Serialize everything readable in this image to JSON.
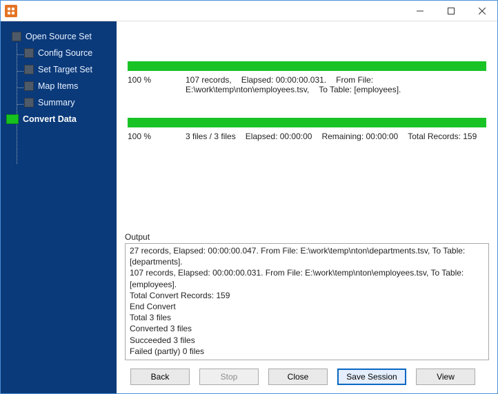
{
  "sidebar": {
    "items": [
      {
        "label": "Open Source Set"
      },
      {
        "label": "Config Source"
      },
      {
        "label": "Set Target Set"
      },
      {
        "label": "Map Items"
      },
      {
        "label": "Summary"
      },
      {
        "label": "Convert Data"
      }
    ]
  },
  "progress": {
    "file": {
      "percent_label": "100 %",
      "records": "107 records,",
      "fromfile": "E:\\work\\temp\\nton\\employees.tsv,",
      "elapsed": "Elapsed: 00:00:00.031.",
      "from_label": "From File:",
      "to_label": "To Table: [employees]."
    },
    "total": {
      "percent_label": "100 %",
      "files": "3 files / 3 files",
      "elapsed": "Elapsed: 00:00:00",
      "remaining": "Remaining: 00:00:00",
      "total_records": "Total Records: 159"
    }
  },
  "output": {
    "label": "Output",
    "lines": [
      "27 records,    Elapsed: 00:00:00.047.    From File: E:\\work\\temp\\nton\\departments.tsv,    To Table: [departments].",
      "107 records,    Elapsed: 00:00:00.031.    From File: E:\\work\\temp\\nton\\employees.tsv,    To Table: [employees].",
      "Total Convert Records: 159",
      "End Convert",
      "Total 3 files",
      "Converted 3 files",
      "Succeeded 3 files",
      "Failed (partly) 0 files"
    ]
  },
  "buttons": {
    "back": "Back",
    "stop": "Stop",
    "close": "Close",
    "save_session": "Save Session",
    "view": "View"
  }
}
